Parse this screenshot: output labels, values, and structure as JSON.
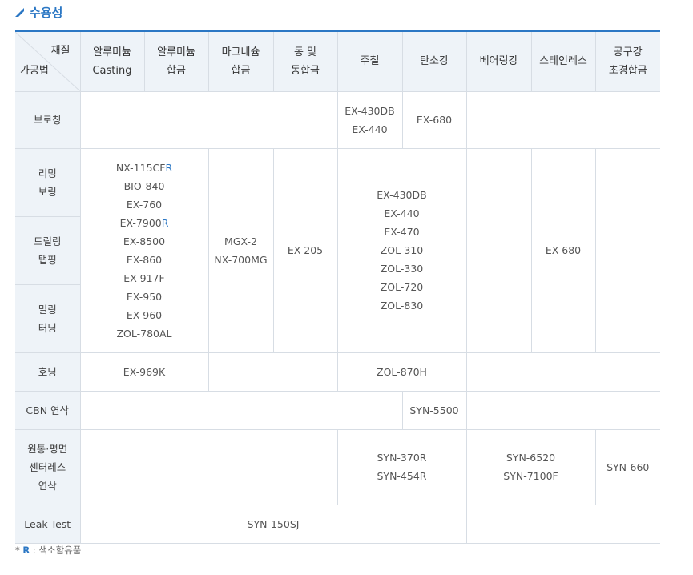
{
  "title": "수용성",
  "corner": {
    "top": "재질",
    "bottom": "가공법"
  },
  "columns": [
    {
      "l1": "알루미늄",
      "l2": "Casting"
    },
    {
      "l1": "알루미늄",
      "l2": "합금"
    },
    {
      "l1": "마그네슘",
      "l2": "합금"
    },
    {
      "l1": "동 및",
      "l2": "동합금"
    },
    {
      "l1": "주철",
      "l2": ""
    },
    {
      "l1": "탄소강",
      "l2": ""
    },
    {
      "l1": "베어링강",
      "l2": ""
    },
    {
      "l1": "스테인레스",
      "l2": ""
    },
    {
      "l1": "공구강",
      "l2": "초경합금"
    }
  ],
  "rows": {
    "broaching": {
      "label": "브로칭",
      "cast_iron": [
        "EX-430DB",
        "EX-440"
      ],
      "carbon_steel": "EX-680"
    },
    "reaming": {
      "l1": "리밍",
      "l2": "보링"
    },
    "drilling": {
      "l1": "드릴링",
      "l2": "탭핑"
    },
    "milling": {
      "l1": "밀링",
      "l2": "터닝"
    },
    "group_aluminum": [
      "NX-115CF",
      "BIO-840",
      "EX-760",
      "EX-7900",
      "EX-8500",
      "EX-860",
      "EX-917F",
      "EX-950",
      "EX-960",
      "ZOL-780AL"
    ],
    "group_aluminum_r_suffix": "R",
    "group_magnesium": [
      "MGX-2",
      "NX-700MG"
    ],
    "group_copper": "EX-205",
    "group_iron_steel": [
      "EX-430DB",
      "EX-440",
      "EX-470",
      "ZOL-310",
      "ZOL-330",
      "ZOL-720",
      "ZOL-830"
    ],
    "group_stainless": "EX-680",
    "honing": {
      "label": "호닝",
      "aluminum": "EX-969K",
      "iron_steel": "ZOL-870H"
    },
    "cbn": {
      "label": "CBN 연삭",
      "carbon_steel": "SYN-5500"
    },
    "centerless": {
      "l1": "원통·평면",
      "l2": "센터레스",
      "l3": "연삭",
      "iron_steel": [
        "SYN-370R",
        "SYN-454R"
      ],
      "bearing_stainless": [
        "SYN-6520",
        "SYN-7100F"
      ],
      "tool_steel": "SYN-660"
    },
    "leak": {
      "label": "Leak Test",
      "value": "SYN-150SJ"
    }
  },
  "footnote": {
    "star": "*",
    "r": "R",
    "text": " : 색소함유품"
  },
  "colors": {
    "accent": "#2b77c4",
    "header_bg": "#eef3f8",
    "border": "#d7dde4"
  }
}
